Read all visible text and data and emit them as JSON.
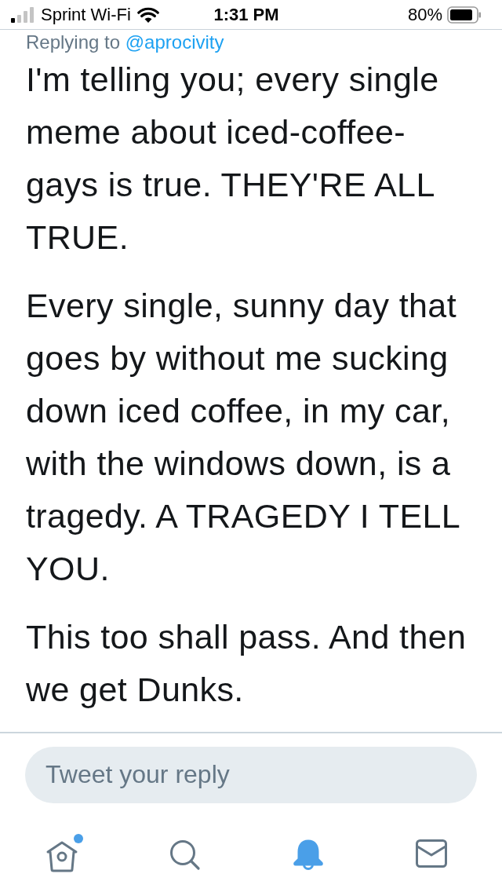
{
  "status_bar": {
    "carrier": "Sprint Wi-Fi",
    "time": "1:31 PM",
    "battery": "80%"
  },
  "reply_context": {
    "label": "Replying to",
    "handle": "@aprocivity"
  },
  "tweet": {
    "paragraphs": [
      "I'm telling you; every single meme about iced-coffee-gays is true. THEY'RE ALL TRUE.",
      "Every single, sunny day that goes by without me sucking down iced coffee, in my car, with the windows down, is a tragedy. A TRAGEDY I TELL YOU.",
      "This too shall pass. And then we get Dunks."
    ]
  },
  "reply_field": {
    "placeholder": "Tweet your reply"
  },
  "tab_bar": [
    {
      "kind": "home",
      "selected": false,
      "badge": true
    },
    {
      "kind": "search",
      "selected": false,
      "badge": false
    },
    {
      "kind": "notifications",
      "selected": true,
      "badge": false
    },
    {
      "kind": "messages",
      "selected": false,
      "badge": false
    }
  ]
}
